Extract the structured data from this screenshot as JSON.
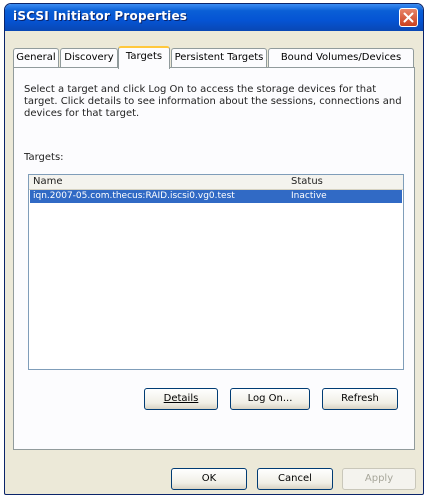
{
  "window": {
    "title": "iSCSI Initiator Properties"
  },
  "tabs": [
    {
      "label": "General"
    },
    {
      "label": "Discovery"
    },
    {
      "label": "Targets"
    },
    {
      "label": "Persistent Targets"
    },
    {
      "label": "Bound Volumes/Devices"
    }
  ],
  "targets_tab": {
    "description": "Select a target and click Log On to access the storage devices for that target. Click details to see information about the sessions, connections and devices for that target.",
    "targets_label": "Targets:",
    "columns": {
      "name": "Name",
      "status": "Status"
    },
    "rows": [
      {
        "name": "iqn.2007-05.com.thecus:RAID.iscsi0.vg0.test",
        "status": "Inactive"
      }
    ],
    "buttons": {
      "details": "Details",
      "log_on": "Log On...",
      "refresh": "Refresh"
    }
  },
  "dialog_buttons": {
    "ok": "OK",
    "cancel": "Cancel",
    "apply": "Apply"
  },
  "icons": {
    "close": "close-icon"
  }
}
